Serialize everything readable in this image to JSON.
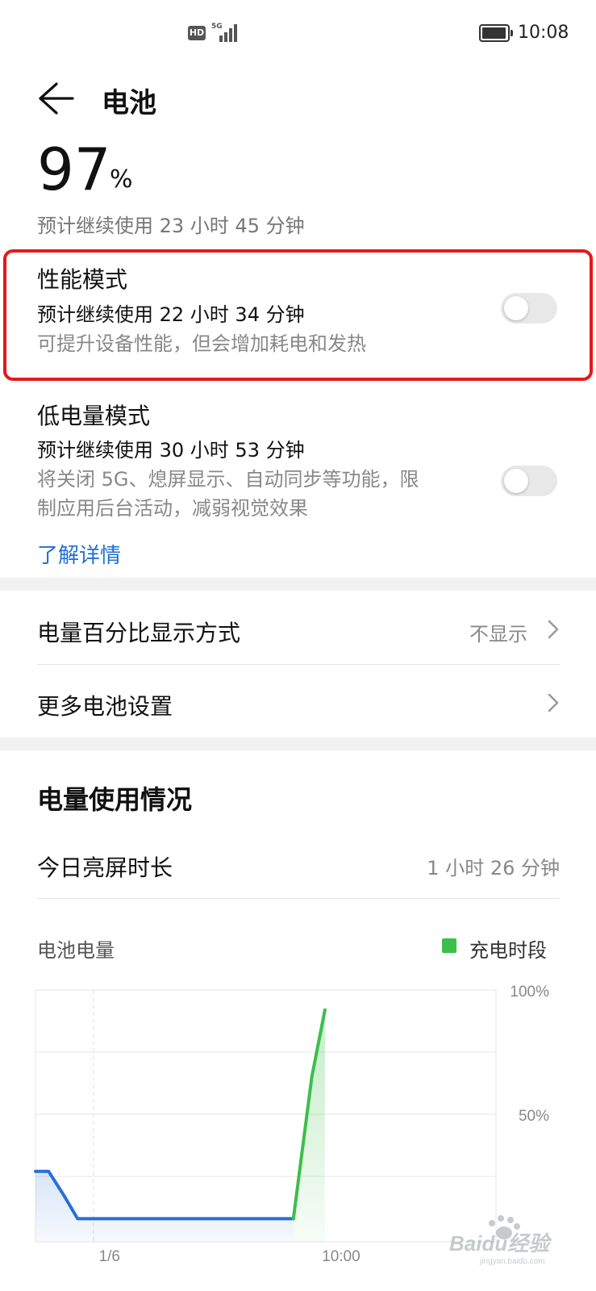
{
  "status_bar": {
    "hd": "HD",
    "network": "5G",
    "time": "10:08",
    "battery_level": 0.97
  },
  "header": {
    "title": "电池"
  },
  "battery": {
    "level_number": "97",
    "level_unit": "%",
    "remaining": "预计继续使用 23 小时 45 分钟"
  },
  "performance_mode": {
    "title": "性能模式",
    "estimate": "预计继续使用 22 小时 34 分钟",
    "description": "可提升设备性能，但会增加耗电和发热",
    "enabled": false
  },
  "low_power_mode": {
    "title": "低电量模式",
    "estimate": "预计继续使用 30 小时 53 分钟",
    "description_line1": "将关闭 5G、熄屏显示、自动同步等功能，限",
    "description_line2": "制应用后台活动，减弱视觉效果",
    "learn_more": "了解详情",
    "enabled": false
  },
  "settings_list": {
    "percentage_display_label": "电量百分比显示方式",
    "percentage_display_value": "不显示",
    "more_settings_label": "更多电池设置"
  },
  "usage": {
    "section_title": "电量使用情况",
    "screen_time_label": "今日亮屏时长",
    "screen_time_value": "1 小时 26 分钟"
  },
  "chart_data": {
    "type": "line",
    "title": "电池电量",
    "legend": [
      {
        "name": "充电时段",
        "color": "#3bbf4a"
      }
    ],
    "y_ticks": [
      "100%",
      "50%"
    ],
    "ylim": [
      0,
      100
    ],
    "x_ticks": [
      "1/6",
      "10:00"
    ],
    "series": [
      {
        "name": "",
        "color": "#2a6fd6",
        "points": [
          [
            0,
            27
          ],
          [
            5,
            27
          ],
          [
            11,
            17
          ],
          [
            16,
            8
          ],
          [
            98,
            8
          ]
        ]
      },
      {
        "name": "充电时段",
        "color": "#3bbf4a",
        "points": [
          [
            98,
            8
          ],
          [
            105,
            65
          ],
          [
            110,
            92
          ]
        ]
      }
    ],
    "x_range": [
      0,
      175
    ]
  },
  "watermark": {
    "text": "Baidu经验",
    "sub": "jingyan.baidu.com"
  }
}
